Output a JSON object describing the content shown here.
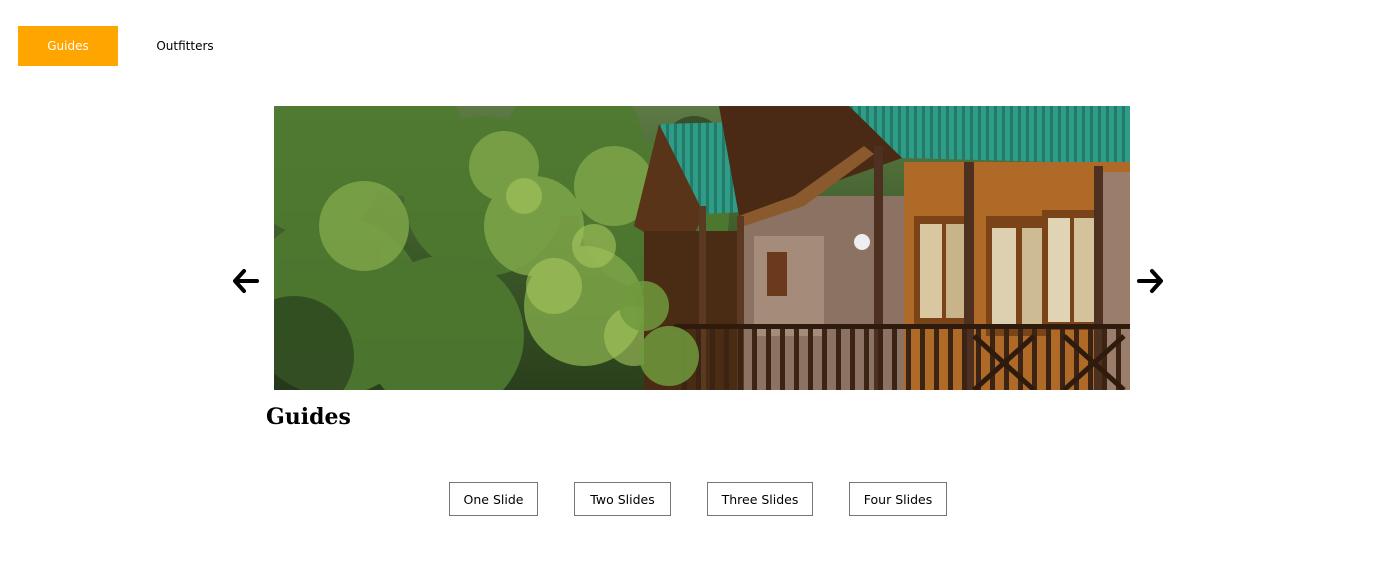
{
  "tabs": [
    {
      "label": "Guides",
      "active": true
    },
    {
      "label": "Outfitters",
      "active": false
    }
  ],
  "carousel": {
    "prev_icon": "arrow-left-icon",
    "next_icon": "arrow-right-icon",
    "image_icon": "photo-forest-lodge",
    "slide_title": "Guides"
  },
  "slide_buttons": [
    {
      "label": "One Slide"
    },
    {
      "label": "Two Slides"
    },
    {
      "label": "Three Slides"
    },
    {
      "label": "Four Slides"
    }
  ],
  "colors": {
    "accent": "#FFA500",
    "roof": "#2E9C86",
    "foliage": "#4E7A2E",
    "wood": "#8A4B1C"
  }
}
